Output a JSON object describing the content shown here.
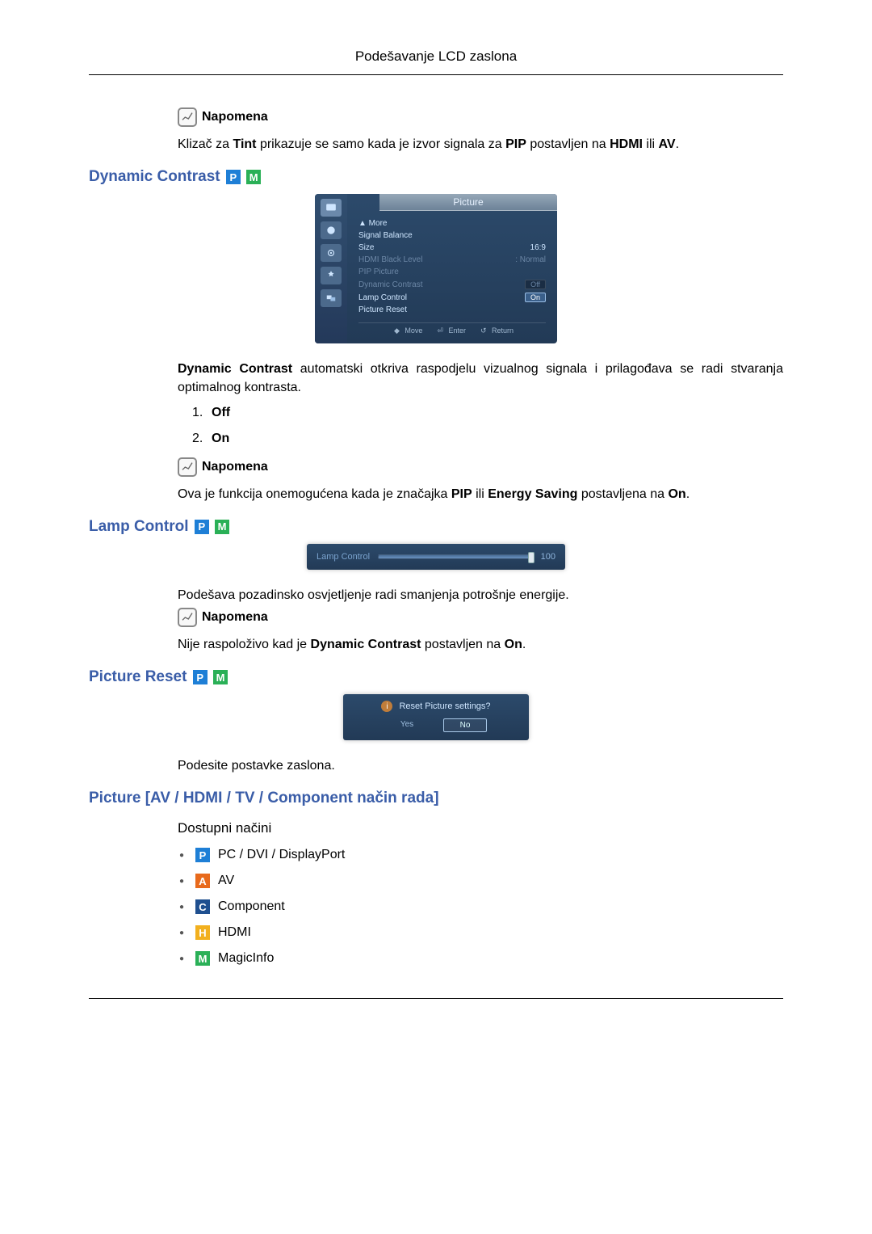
{
  "header": {
    "title": "Podešavanje LCD zaslona"
  },
  "note_label": "Napomena",
  "intro_note_text": "Klizač za Tint prikazuje se samo kada je izvor signala za PIP postavljen na HDMI ili AV.",
  "sections": {
    "dynamic_contrast": {
      "title": "Dynamic Contrast",
      "osd": {
        "header": "Picture",
        "items": {
          "more": "▲ More",
          "signal_balance": "Signal Balance",
          "size": "Size",
          "size_val": "16:9",
          "hdmi_black": "HDMI Black Level",
          "hdmi_black_val": ": Normal",
          "pip_picture": "PIP Picture",
          "dyn_contrast": "Dynamic Contrast",
          "dyn_val": "Off",
          "lamp_control": "Lamp Control",
          "lamp_val": "On",
          "picture_reset": "Picture Reset"
        },
        "footer": {
          "move": "Move",
          "enter": "Enter",
          "return": "Return"
        }
      },
      "desc": "Dynamic Contrast automatski otkriva raspodjelu vizualnog signala i prilagođava se radi stvaranja optimalnog kontrasta.",
      "options": [
        "Off",
        "On"
      ],
      "note_text": "Ova je funkcija onemogućena kada je značajka PIP ili Energy Saving postavljena na On."
    },
    "lamp_control": {
      "title": "Lamp Control",
      "osd": {
        "label": "Lamp Control",
        "value": "100"
      },
      "desc": "Podešava pozadinsko osvjetljenje radi smanjenja potrošnje energije.",
      "note_text": "Nije raspoloživo kad je Dynamic Contrast postavljen na On."
    },
    "picture_reset": {
      "title": "Picture Reset",
      "osd": {
        "question": "Reset Picture settings?",
        "yes": "Yes",
        "no": "No"
      },
      "desc": "Podesite postavke zaslona."
    },
    "picture_mode": {
      "title": "Picture [AV / HDMI / TV / Component način rada]",
      "sub": "Dostupni načini",
      "modes": {
        "p": "PC / DVI / DisplayPort",
        "a": "AV",
        "c": "Component",
        "h": "HDMI",
        "m": "MagicInfo"
      }
    }
  },
  "mode_icons": {
    "p": "P",
    "a": "A",
    "c": "C",
    "h": "H",
    "m": "M"
  }
}
